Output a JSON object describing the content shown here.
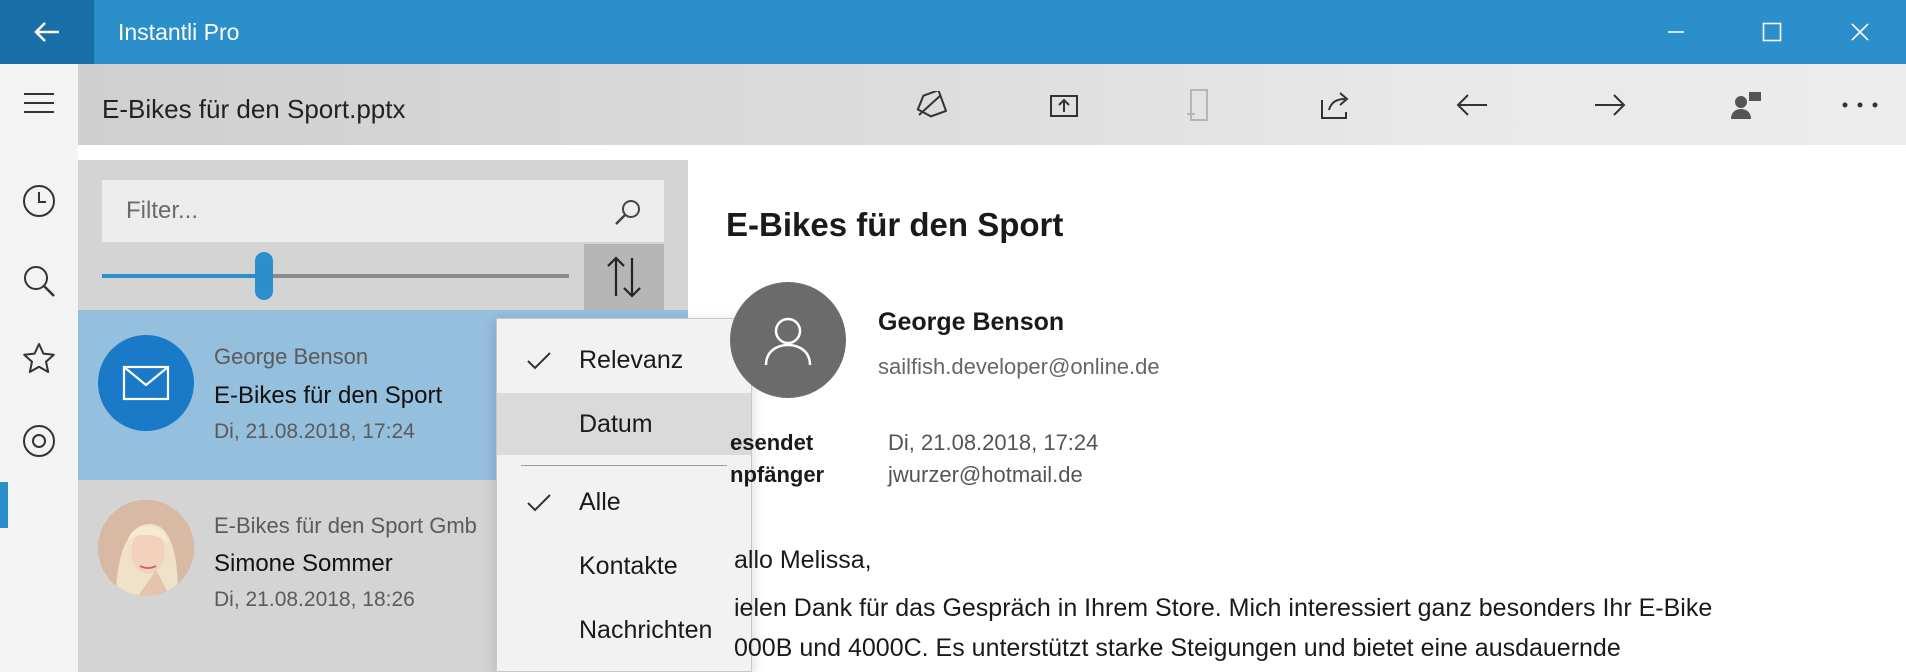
{
  "app": {
    "title": "Instantli Pro"
  },
  "toolbar": {
    "doc_title": "E-Bikes für den Sport.pptx"
  },
  "filter": {
    "placeholder": "Filter..."
  },
  "list": {
    "items": [
      {
        "from": "George Benson",
        "subject": "E-Bikes für den Sport",
        "date": "Di, 21.08.2018, 17:24"
      },
      {
        "from": "E-Bikes für den Sport Gmb",
        "subject": "Simone Sommer",
        "date": "Di, 21.08.2018, 18:26"
      }
    ]
  },
  "slider": {
    "value_percent": 35
  },
  "menu": {
    "items": [
      {
        "label": "Relevanz",
        "checked": true
      },
      {
        "label": "Datum",
        "checked": false
      },
      {
        "label": "Alle",
        "checked": true
      },
      {
        "label": "Kontakte",
        "checked": false
      },
      {
        "label": "Nachrichten",
        "checked": false
      }
    ]
  },
  "reading": {
    "title": "E-Bikes für den Sport",
    "sender_name": "George Benson",
    "sender_email": "sailfish.developer@online.de",
    "sent_label": "esendet",
    "sent_value": "Di, 21.08.2018, 17:24",
    "to_label": "npfänger",
    "to_value": "jwurzer@hotmail.de",
    "body": [
      "allo Melissa,",
      "ielen Dank für das Gespräch in Ihrem Store. Mich interessiert ganz besonders Ihr E-Bike",
      "000B und 4000C. Es unterstützt starke Steigungen und bietet eine ausdauernde"
    ]
  },
  "colors": {
    "accent": "#2b8fcb",
    "back_button": "#1a6fa8",
    "selected_item": "#94bfdd",
    "mail_avatar": "#1a7ac8"
  }
}
